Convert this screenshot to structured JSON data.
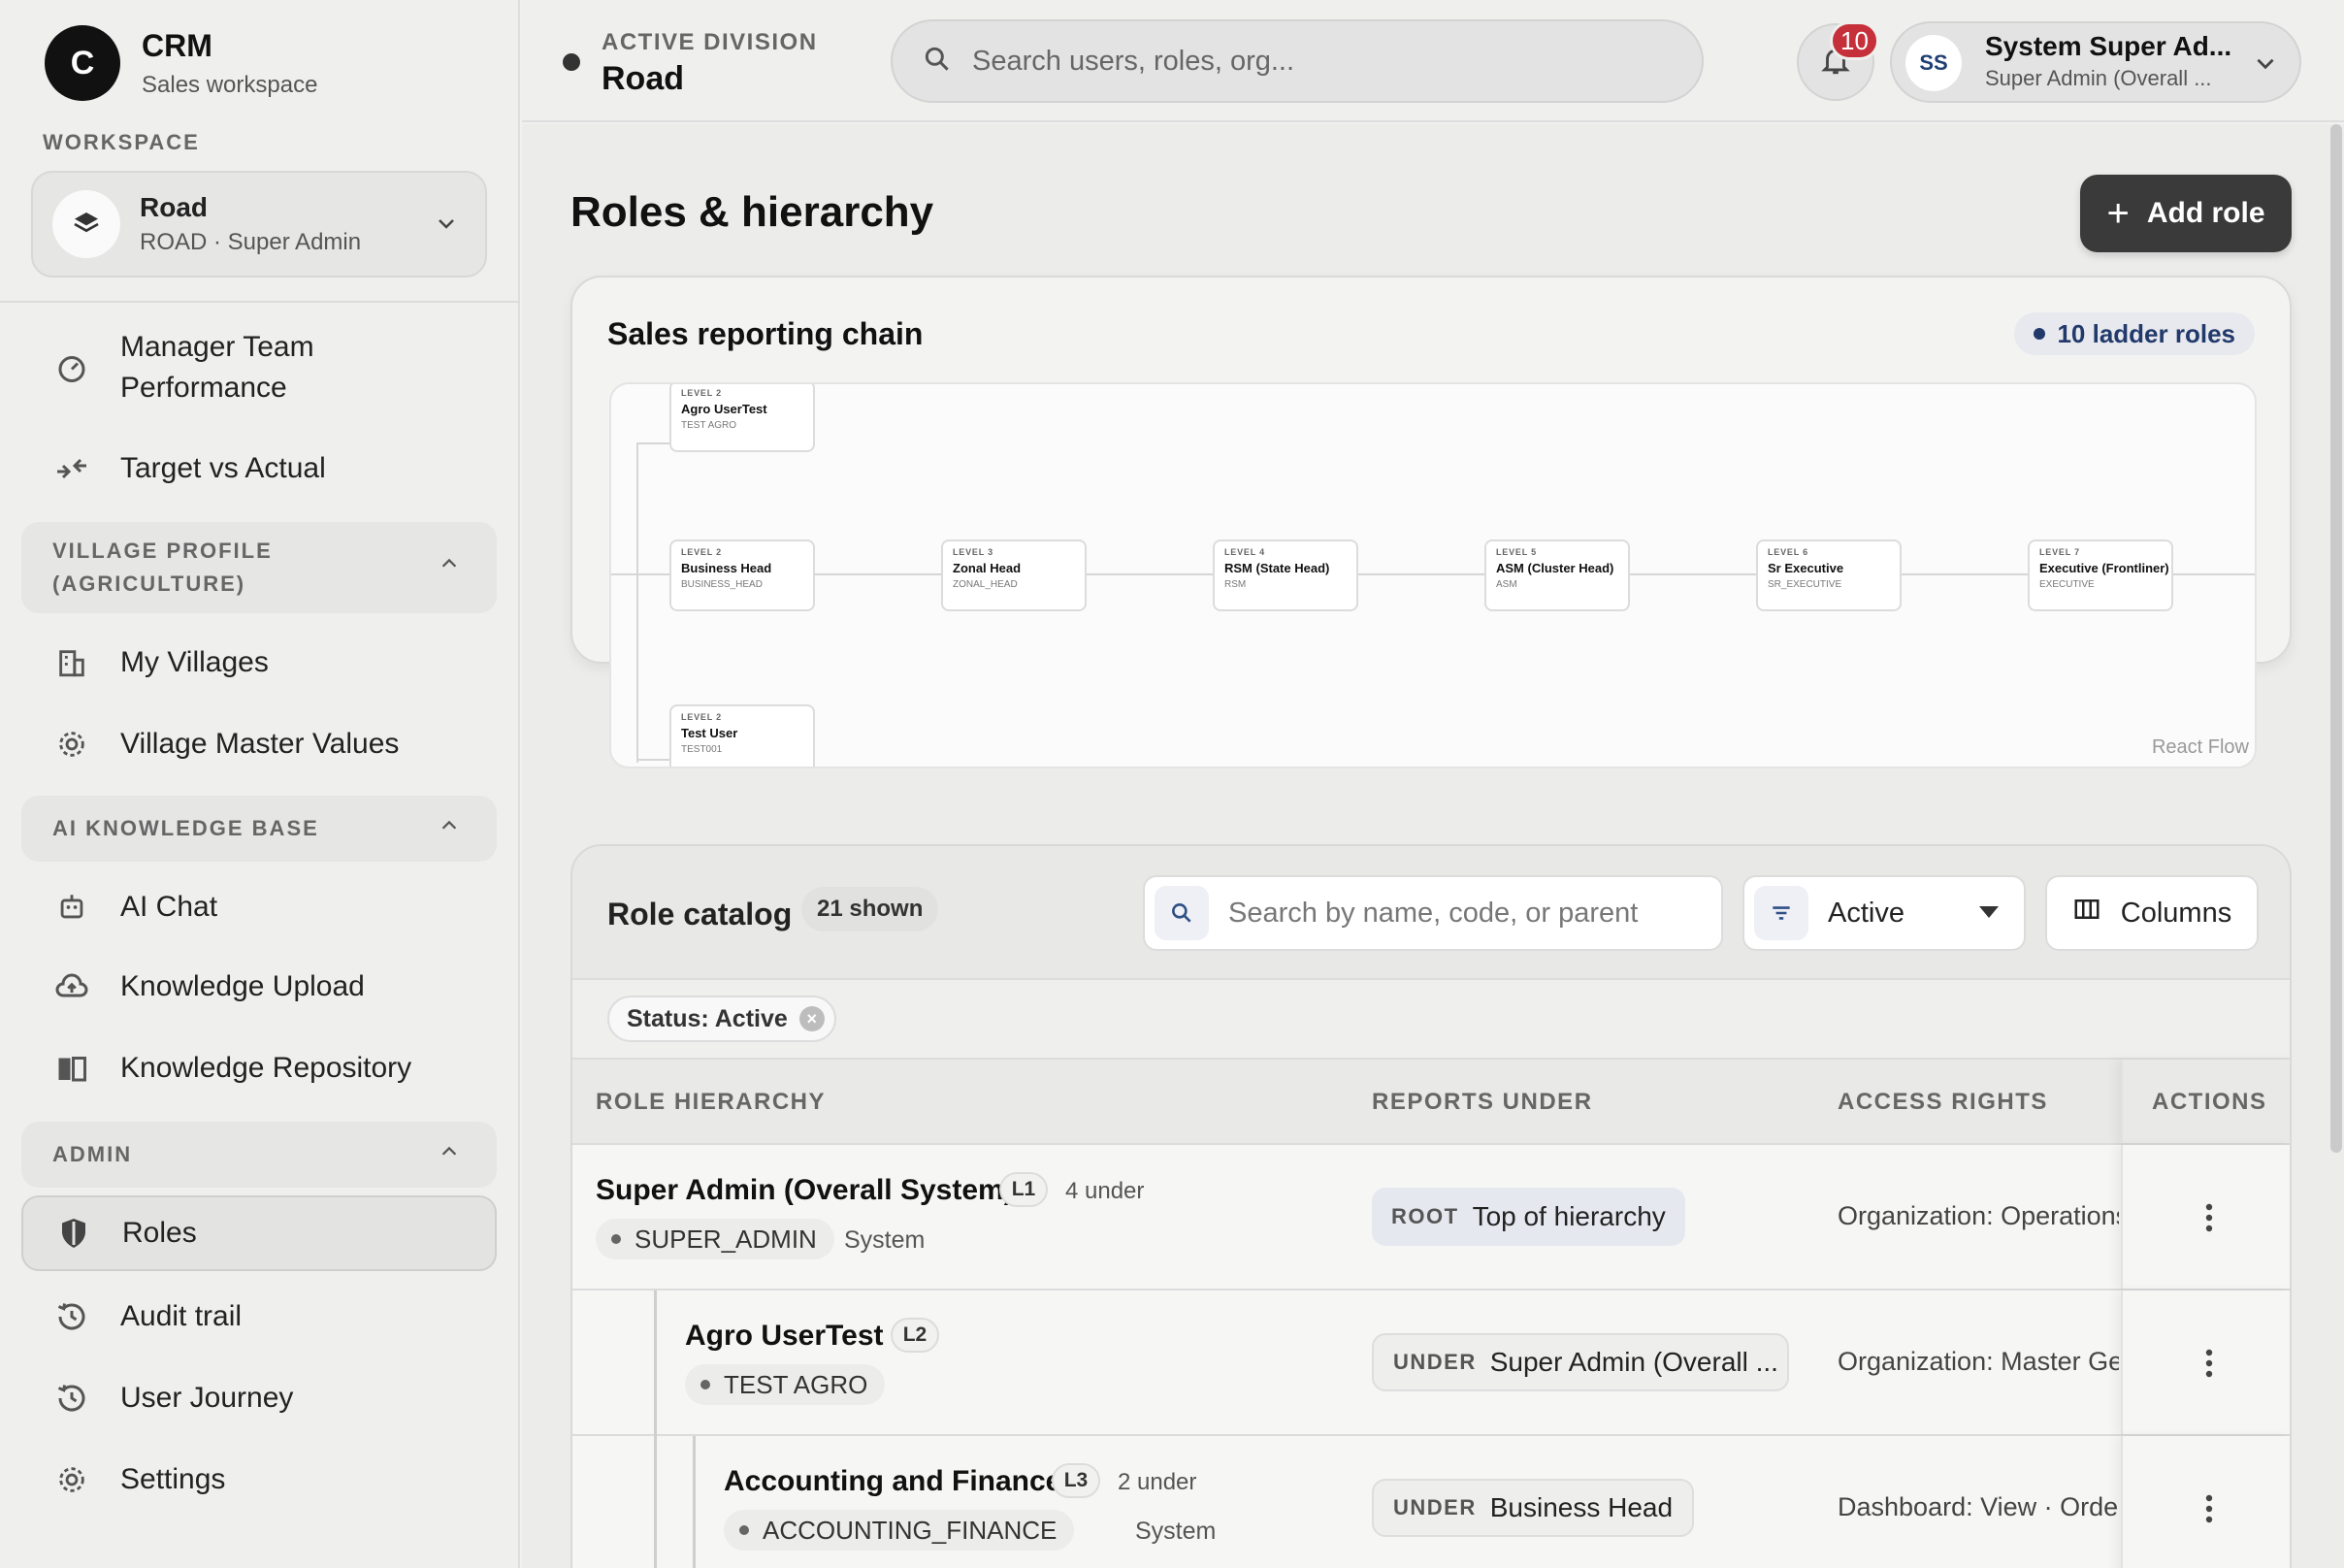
{
  "brand": {
    "logo_letter": "C",
    "title": "CRM",
    "subtitle": "Sales workspace"
  },
  "workspace": {
    "section_label": "WORKSPACE",
    "name": "Road",
    "role": "ROAD · Super Admin"
  },
  "nav": {
    "top_items": [
      {
        "label": "Manager Team Performance",
        "icon": "gauge-icon"
      },
      {
        "label": "Target vs Actual",
        "icon": "arrows-in-icon"
      }
    ],
    "groups": [
      {
        "label": "VILLAGE PROFILE (AGRICULTURE)",
        "items": [
          {
            "label": "My Villages",
            "icon": "building-icon"
          },
          {
            "label": "Village Master Values",
            "icon": "gear-icon"
          }
        ]
      },
      {
        "label": "AI KNOWLEDGE BASE",
        "items": [
          {
            "label": "AI Chat",
            "icon": "robot-icon"
          },
          {
            "label": "Knowledge Upload",
            "icon": "cloud-upload-icon"
          },
          {
            "label": "Knowledge Repository",
            "icon": "book-icon"
          }
        ]
      },
      {
        "label": "ADMIN",
        "items": [
          {
            "label": "Roles",
            "icon": "shield-icon",
            "active": true
          },
          {
            "label": "Audit trail",
            "icon": "history-icon"
          },
          {
            "label": "User Journey",
            "icon": "history-icon"
          },
          {
            "label": "Settings",
            "icon": "gear-icon"
          }
        ]
      }
    ]
  },
  "topbar": {
    "division_label": "ACTIVE DIVISION",
    "division_value": "Road",
    "search_placeholder": "Search users, roles, org...",
    "notifications_count": "10",
    "user": {
      "initials": "SS",
      "name": "System Super Ad...",
      "role": "Super Admin (Overall ..."
    }
  },
  "page": {
    "title": "Roles & hierarchy",
    "add_button": "Add role"
  },
  "chain": {
    "title": "Sales reporting chain",
    "ladder_pill": "10 ladder roles",
    "attribution": "React Flow",
    "nodes": [
      {
        "level": "LEVEL 2",
        "name": "Agro UserTest",
        "code": "TEST AGRO"
      },
      {
        "level": "LEVEL 2",
        "name": "Business Head",
        "code": "BUSINESS_HEAD"
      },
      {
        "level": "LEVEL 3",
        "name": "Zonal Head",
        "code": "ZONAL_HEAD"
      },
      {
        "level": "LEVEL 4",
        "name": "RSM (State Head)",
        "code": "RSM"
      },
      {
        "level": "LEVEL 5",
        "name": "ASM (Cluster Head)",
        "code": "ASM"
      },
      {
        "level": "LEVEL 6",
        "name": "Sr Executive",
        "code": "SR_EXECUTIVE"
      },
      {
        "level": "LEVEL 7",
        "name": "Executive (Frontliner)",
        "code": "EXECUTIVE"
      },
      {
        "level": "LEVEL 2",
        "name": "Test User",
        "code": "TEST001"
      }
    ]
  },
  "catalog": {
    "title": "Role catalog",
    "count": "21 shown",
    "search_placeholder": "Search by name, code, or parent",
    "status_value": "Active",
    "columns_button": "Columns",
    "filter_chip": "Status: Active",
    "headers": {
      "hierarchy": "ROLE HIERARCHY",
      "reports": "REPORTS UNDER",
      "access": "ACCESS RIGHTS",
      "actions": "ACTIONS"
    },
    "rows": [
      {
        "name": "Super Admin (Overall System)",
        "level": "L1",
        "under_count": "4 under",
        "code": "SUPER_ADMIN",
        "tag": "System",
        "report_kind": "ROOT",
        "report_value": "Top of hierarchy",
        "access": "Organization: Operations"
      },
      {
        "name": "Agro UserTest",
        "level": "L2",
        "under_count": "",
        "code": "TEST AGRO",
        "tag": "",
        "report_kind": "UNDER",
        "report_value": "Super Admin (Overall ...",
        "access": "Organization: Master Ge"
      },
      {
        "name": "Accounting and Finance",
        "level": "L3",
        "under_count": "2 under",
        "code": "ACCOUNTING_FINANCE",
        "tag": "System",
        "report_kind": "UNDER",
        "report_value": "Business Head",
        "access": "Dashboard: View · Orde"
      }
    ]
  }
}
